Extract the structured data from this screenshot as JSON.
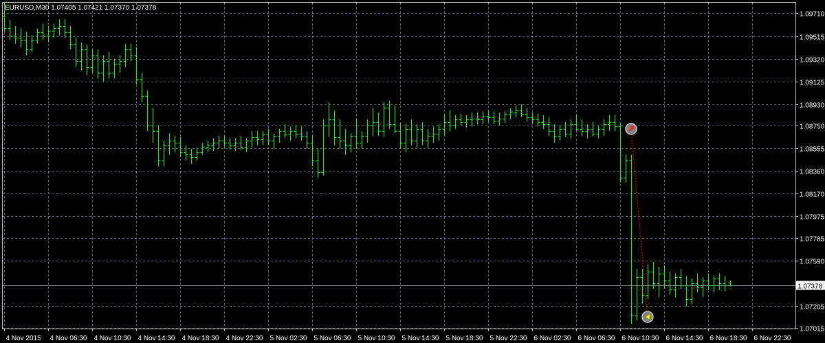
{
  "window": {
    "symbol_line": "EURUSD,M30  1.07405 1.07421 1.07370 1.07378"
  },
  "colors": {
    "background": "#000000",
    "grid": "#5a6470",
    "axis": "#c0c0c0",
    "bar": "#00ff00",
    "current_price_line": "#9aa0a6",
    "current_price_bg": "#ffffff",
    "text": "#ffffff",
    "trade_line": "#ff0000",
    "marker_fill": "#808080"
  },
  "chart_data": {
    "type": "ohlc-bars",
    "title": "",
    "xlabel": "",
    "ylabel": "",
    "symbol": "EURUSD",
    "timeframe": "M30",
    "ylim": [
      1.0701,
      1.098
    ],
    "y_ticks": [
      "1.09710",
      "1.09515",
      "1.09320",
      "1.09125",
      "1.08930",
      "1.08750",
      "1.08555",
      "1.08360",
      "1.08170",
      "1.07975",
      "1.07785",
      "1.07590",
      "1.07205",
      "1.07015"
    ],
    "current_price": "1.07378",
    "x_ticks": [
      "4 Nov 2015",
      "4 Nov 06:30",
      "4 Nov 10:30",
      "4 Nov 14:30",
      "4 Nov 18:30",
      "4 Nov 22:30",
      "5 Nov 02:30",
      "5 Nov 06:30",
      "5 Nov 10:30",
      "5 Nov 14:30",
      "5 Nov 18:30",
      "5 Nov 22:30",
      "6 Nov 02:30",
      "6 Nov 06:30",
      "6 Nov 10:30",
      "6 Nov 14:30",
      "6 Nov 18:30",
      "6 Nov 22:30"
    ],
    "grid": true,
    "bars": [
      [
        1.0968,
        1.098,
        1.0955,
        1.0958
      ],
      [
        1.0958,
        1.0965,
        1.0948,
        1.0952
      ],
      [
        1.0952,
        1.096,
        1.0945,
        1.095
      ],
      [
        1.095,
        1.0958,
        1.0942,
        1.0948
      ],
      [
        1.0948,
        1.0955,
        1.0935,
        1.094
      ],
      [
        1.094,
        1.0952,
        1.0938,
        1.0948
      ],
      [
        1.0948,
        1.0958,
        1.0945,
        1.0955
      ],
      [
        1.0955,
        1.0962,
        1.0948,
        1.0952
      ],
      [
        1.0952,
        1.096,
        1.0946,
        1.0956
      ],
      [
        1.0956,
        1.0962,
        1.095,
        1.0958
      ],
      [
        1.0958,
        1.0966,
        1.0952,
        1.096
      ],
      [
        1.096,
        1.0966,
        1.095,
        1.0955
      ],
      [
        1.0955,
        1.096,
        1.094,
        1.0945
      ],
      [
        1.0945,
        1.095,
        1.0925,
        1.093
      ],
      [
        1.093,
        1.0946,
        1.0922,
        1.094
      ],
      [
        1.094,
        1.0944,
        1.0918,
        1.0925
      ],
      [
        1.0925,
        1.094,
        1.092,
        1.0935
      ],
      [
        1.0935,
        1.094,
        1.0915,
        1.092
      ],
      [
        1.092,
        1.0935,
        1.0912,
        1.093
      ],
      [
        1.093,
        1.0938,
        1.0915,
        1.092
      ],
      [
        1.092,
        1.0932,
        1.0915,
        1.0928
      ],
      [
        1.0928,
        1.0935,
        1.092,
        1.093
      ],
      [
        1.093,
        1.0945,
        1.0925,
        1.094
      ],
      [
        1.094,
        1.0945,
        1.093,
        1.0935
      ],
      [
        1.0935,
        1.0942,
        1.091,
        1.0915
      ],
      [
        1.0915,
        1.092,
        1.0895,
        1.09
      ],
      [
        1.09,
        1.0905,
        1.087,
        1.0875
      ],
      [
        1.0875,
        1.089,
        1.086,
        1.087
      ],
      [
        1.087,
        1.0875,
        1.084,
        1.0845
      ],
      [
        1.0845,
        1.0862,
        1.084,
        1.0858
      ],
      [
        1.0858,
        1.0868,
        1.085,
        1.0862
      ],
      [
        1.0862,
        1.0866,
        1.0852,
        1.086
      ],
      [
        1.086,
        1.0865,
        1.0848,
        1.0852
      ],
      [
        1.0852,
        1.0858,
        1.0845,
        1.085
      ],
      [
        1.085,
        1.0855,
        1.0842,
        1.0848
      ],
      [
        1.0848,
        1.0856,
        1.0845,
        1.0852
      ],
      [
        1.0852,
        1.086,
        1.085,
        1.0856
      ],
      [
        1.0856,
        1.0862,
        1.0852,
        1.0858
      ],
      [
        1.0858,
        1.0864,
        1.0853,
        1.086
      ],
      [
        1.086,
        1.0866,
        1.0855,
        1.0862
      ],
      [
        1.0862,
        1.0866,
        1.0856,
        1.086
      ],
      [
        1.086,
        1.0864,
        1.0854,
        1.0858
      ],
      [
        1.0858,
        1.0864,
        1.0853,
        1.086
      ],
      [
        1.086,
        1.0866,
        1.0854,
        1.0856
      ],
      [
        1.0856,
        1.0864,
        1.0852,
        1.0862
      ],
      [
        1.0862,
        1.087,
        1.0856,
        1.0865
      ],
      [
        1.0865,
        1.087,
        1.0858,
        1.0863
      ],
      [
        1.0863,
        1.087,
        1.0858,
        1.0868
      ],
      [
        1.0868,
        1.0872,
        1.0858,
        1.0862
      ],
      [
        1.0862,
        1.0868,
        1.0855,
        1.0866
      ],
      [
        1.0866,
        1.0872,
        1.086,
        1.087
      ],
      [
        1.087,
        1.0876,
        1.0864,
        1.0868
      ],
      [
        1.0868,
        1.0874,
        1.0862,
        1.087
      ],
      [
        1.087,
        1.0875,
        1.0864,
        1.0868
      ],
      [
        1.0868,
        1.0874,
        1.0862,
        1.0866
      ],
      [
        1.0866,
        1.087,
        1.0855,
        1.086
      ],
      [
        1.086,
        1.0866,
        1.084,
        1.0845
      ],
      [
        1.0845,
        1.0855,
        1.083,
        1.0835
      ],
      [
        1.0835,
        1.088,
        1.0832,
        1.0875
      ],
      [
        1.0875,
        1.0895,
        1.0865,
        1.088
      ],
      [
        1.088,
        1.0888,
        1.0858,
        1.0865
      ],
      [
        1.0865,
        1.088,
        1.0855,
        1.0862
      ],
      [
        1.0862,
        1.0872,
        1.085,
        1.0858
      ],
      [
        1.0858,
        1.0868,
        1.0852,
        1.0866
      ],
      [
        1.0866,
        1.088,
        1.0855,
        1.086
      ],
      [
        1.086,
        1.087,
        1.0855,
        1.0866
      ],
      [
        1.0866,
        1.088,
        1.086,
        1.0875
      ],
      [
        1.0875,
        1.089,
        1.0866,
        1.0878
      ],
      [
        1.0878,
        1.0886,
        1.0866,
        1.087
      ],
      [
        1.087,
        1.0895,
        1.0865,
        1.089
      ],
      [
        1.089,
        1.0896,
        1.0872,
        1.0876
      ],
      [
        1.0876,
        1.0892,
        1.0868,
        1.087
      ],
      [
        1.087,
        1.0876,
        1.0855,
        1.086
      ],
      [
        1.086,
        1.0876,
        1.0852,
        1.0872
      ],
      [
        1.0872,
        1.088,
        1.0858,
        1.0862
      ],
      [
        1.0862,
        1.0876,
        1.0856,
        1.0872
      ],
      [
        1.0872,
        1.0878,
        1.0858,
        1.0862
      ],
      [
        1.0862,
        1.0872,
        1.0856,
        1.0866
      ],
      [
        1.0866,
        1.0874,
        1.086,
        1.0868
      ],
      [
        1.0868,
        1.0876,
        1.0862,
        1.0872
      ],
      [
        1.0872,
        1.0885,
        1.0866,
        1.0878
      ],
      [
        1.0878,
        1.0888,
        1.087,
        1.0875
      ],
      [
        1.0875,
        1.0884,
        1.0872,
        1.088
      ],
      [
        1.088,
        1.0885,
        1.0875,
        1.0878
      ],
      [
        1.0878,
        1.0884,
        1.0873,
        1.088
      ],
      [
        1.088,
        1.0886,
        1.0874,
        1.0881
      ],
      [
        1.0881,
        1.0886,
        1.0876,
        1.088
      ],
      [
        1.088,
        1.0887,
        1.0876,
        1.0883
      ],
      [
        1.0883,
        1.0888,
        1.0878,
        1.0882
      ],
      [
        1.0882,
        1.0887,
        1.0876,
        1.0879
      ],
      [
        1.0879,
        1.0886,
        1.0875,
        1.0881
      ],
      [
        1.0881,
        1.0887,
        1.0877,
        1.0884
      ],
      [
        1.0884,
        1.089,
        1.088,
        1.0886
      ],
      [
        1.0886,
        1.0892,
        1.0882,
        1.0888
      ],
      [
        1.0888,
        1.0893,
        1.0882,
        1.0885
      ],
      [
        1.0885,
        1.089,
        1.0878,
        1.0882
      ],
      [
        1.0882,
        1.0886,
        1.0876,
        1.088
      ],
      [
        1.088,
        1.0885,
        1.0874,
        1.0878
      ],
      [
        1.0878,
        1.0884,
        1.0872,
        1.0876
      ],
      [
        1.0876,
        1.0882,
        1.0866,
        1.087
      ],
      [
        1.087,
        1.0876,
        1.086,
        1.0866
      ],
      [
        1.0866,
        1.0875,
        1.0862,
        1.0872
      ],
      [
        1.0872,
        1.0878,
        1.0865,
        1.0868
      ],
      [
        1.0868,
        1.088,
        1.0864,
        1.0876
      ],
      [
        1.0876,
        1.0884,
        1.087,
        1.0872
      ],
      [
        1.0872,
        1.088,
        1.0866,
        1.087
      ],
      [
        1.087,
        1.0876,
        1.0864,
        1.0872
      ],
      [
        1.0872,
        1.0878,
        1.0866,
        1.0868
      ],
      [
        1.0868,
        1.0875,
        1.0864,
        1.0872
      ],
      [
        1.0872,
        1.088,
        1.0866,
        1.0876
      ],
      [
        1.0876,
        1.0884,
        1.087,
        1.0878
      ],
      [
        1.0878,
        1.0884,
        1.087,
        1.0874
      ],
      [
        1.0874,
        1.0876,
        1.0826,
        1.083
      ],
      [
        1.083,
        1.085,
        1.0826,
        1.0845
      ],
      [
        1.0845,
        1.085,
        1.0705,
        1.0712
      ],
      [
        1.0712,
        1.0752,
        1.0708,
        1.0745
      ],
      [
        1.0745,
        1.0752,
        1.0722,
        1.073
      ],
      [
        1.073,
        1.0756,
        1.0726,
        1.075
      ],
      [
        1.075,
        1.0758,
        1.0735,
        1.074
      ],
      [
        1.074,
        1.0754,
        1.0728,
        1.0748
      ],
      [
        1.0748,
        1.0755,
        1.0735,
        1.0742
      ],
      [
        1.0742,
        1.075,
        1.073,
        1.0735
      ],
      [
        1.0735,
        1.0748,
        1.0728,
        1.0745
      ],
      [
        1.0745,
        1.0752,
        1.0735,
        1.0738
      ],
      [
        1.0738,
        1.0746,
        1.072,
        1.0726
      ],
      [
        1.0726,
        1.0744,
        1.0722,
        1.074
      ],
      [
        1.074,
        1.0748,
        1.0732,
        1.0736
      ],
      [
        1.0736,
        1.0745,
        1.0728,
        1.0742
      ],
      [
        1.0742,
        1.0748,
        1.0734,
        1.0738
      ],
      [
        1.0738,
        1.0746,
        1.0732,
        1.0744
      ],
      [
        1.0744,
        1.0748,
        1.0734,
        1.074
      ],
      [
        1.074,
        1.0746,
        1.0733,
        1.0738
      ],
      [
        1.07405,
        1.07421,
        1.0737,
        1.07378
      ]
    ],
    "markers": [
      {
        "bar": 114,
        "price": 1.0872,
        "kind": "entry",
        "symbol": "arrow-up-right"
      },
      {
        "bar": 117,
        "price": 1.0711,
        "kind": "exit",
        "symbol": "arrow-left"
      }
    ]
  }
}
